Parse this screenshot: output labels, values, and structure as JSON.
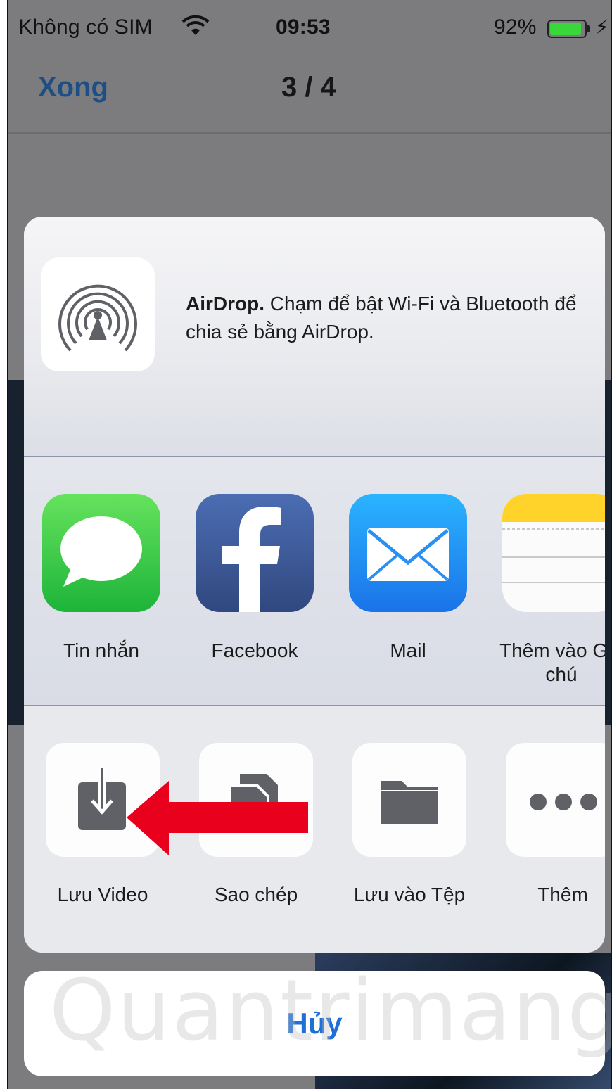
{
  "status_bar": {
    "carrier": "Không có SIM",
    "time": "09:53",
    "battery_percent": "92%",
    "battery_level": 0.92,
    "wifi_icon": "wifi-icon",
    "charging_icon": "bolt-icon"
  },
  "nav": {
    "done_label": "Xong",
    "page_counter": "3 / 4"
  },
  "share_sheet": {
    "airdrop": {
      "icon": "airdrop-icon",
      "title": "AirDrop.",
      "description": " Chạm để bật Wi-Fi và Bluetooth để chia sẻ bằng AirDrop."
    },
    "apps": [
      {
        "label": "Tin nhắn",
        "icon": "messages-icon",
        "color": "#36c84b"
      },
      {
        "label": "Facebook",
        "icon": "facebook-icon",
        "color": "#3b5998"
      },
      {
        "label": "Mail",
        "icon": "mail-icon",
        "color": "#1e8df5"
      },
      {
        "label": "Thêm vào Ghi chú",
        "icon": "notes-icon",
        "color": "#ffd426"
      }
    ],
    "actions": [
      {
        "label": "Lưu Video",
        "icon": "save-video-icon"
      },
      {
        "label": "Sao chép",
        "icon": "copy-icon"
      },
      {
        "label": "Lưu vào Tệp",
        "icon": "folder-icon"
      },
      {
        "label": "Thêm",
        "icon": "more-icon"
      }
    ],
    "cancel_label": "Hủy"
  },
  "annotation": {
    "arrow_color": "#e8001c"
  }
}
